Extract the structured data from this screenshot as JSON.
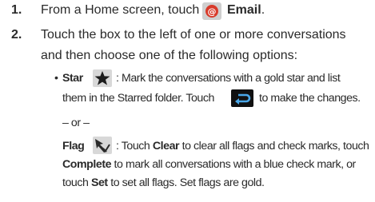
{
  "steps": [
    {
      "number": "1.",
      "text_before": "From a Home screen, touch",
      "text_bold": "Email",
      "text_after": "."
    },
    {
      "number": "2.",
      "line1": "Touch the box to the left of one or more conversations",
      "line2": "and then choose one of the following options:"
    }
  ],
  "options": {
    "bullet": "•",
    "star": {
      "label": "Star",
      "sep": ":",
      "line1_text": "Mark the conversations with a gold star and list",
      "line2_before": "them in the Starred folder. Touch",
      "line2_after": "to make the changes."
    },
    "or_text": "– or –",
    "flag": {
      "label": "Flag",
      "sep": ":",
      "l1_a": "Touch",
      "l1_clear": "Clear",
      "l1_b": "to clear all flags and check marks, touch",
      "l2_complete": "Complete",
      "l2_b": "to mark all conversations with a blue check mark, or",
      "l3_a": "touch",
      "l3_set": "Set",
      "l3_b": "to set all flags. Set flags are gold."
    }
  },
  "icons": {
    "email": "email-icon",
    "star": "star-icon",
    "back": "back-arrow-icon",
    "flag": "flag-checkmark-icon"
  },
  "colors": {
    "email_red": "#d83a2a",
    "icon_bg": "#cfcfcf",
    "star": "#1c1c1c",
    "back_bg": "#111111",
    "back_arrow": "#4aa7e8",
    "flag_bg": "#d8d8d8"
  }
}
